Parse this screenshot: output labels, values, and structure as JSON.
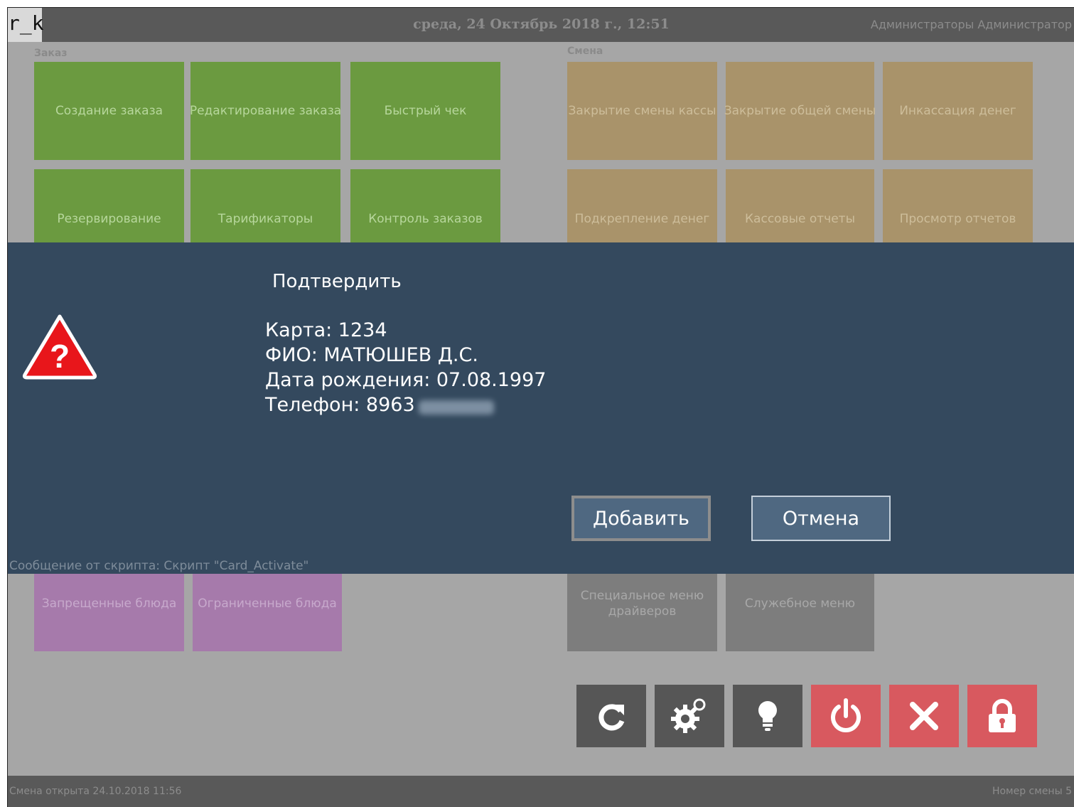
{
  "header": {
    "logo": "r_k",
    "datetime": "среда, 24 Октябрь 2018 г., 12:51",
    "user": "Администраторы Администратор"
  },
  "sections": {
    "order_label": "Заказ",
    "shift_label": "Смена"
  },
  "order_tiles": [
    "Создание заказа",
    "Редактирование заказа",
    "Быстрый чек",
    "Резервирование",
    "Тарификаторы",
    "Контроль заказов"
  ],
  "shift_tiles": [
    "Закрытие смены кассы",
    "Закрытие общей смены",
    "Инкассация денег",
    "Подкрепление денег",
    "Кассовые отчеты",
    "Просмотр отчетов"
  ],
  "lower_tiles": [
    "Запрещенные блюда",
    "Ограниченные блюда",
    "Специальное меню драйверов",
    "Служебное меню"
  ],
  "dialog": {
    "title": "Подтвердить",
    "card": "Карта: 1234",
    "name": "ФИО: МАТЮШЕВ Д.С.",
    "birth": "Дата рождения: 07.08.1997",
    "phone": "Телефон: 8963",
    "add_label": "Добавить",
    "cancel_label": "Отмена",
    "script_message": "Сообщение от скрипта: Скрипт \"Card_Activate\""
  },
  "icon_buttons": [
    "refresh-icon",
    "gears-icon",
    "lightbulb-icon",
    "power-icon",
    "close-icon",
    "lock-icon"
  ],
  "colors": {
    "order_green": "#6b9a40",
    "shift_tan": "#a9936a",
    "menu_purple": "#a67aab",
    "dialog_bg": "#34495e",
    "danger_red": "#d8595f"
  },
  "status": {
    "shift_opened": "Смена открыта 24.10.2018 11:56",
    "shift_number": "Номер смены 5"
  }
}
